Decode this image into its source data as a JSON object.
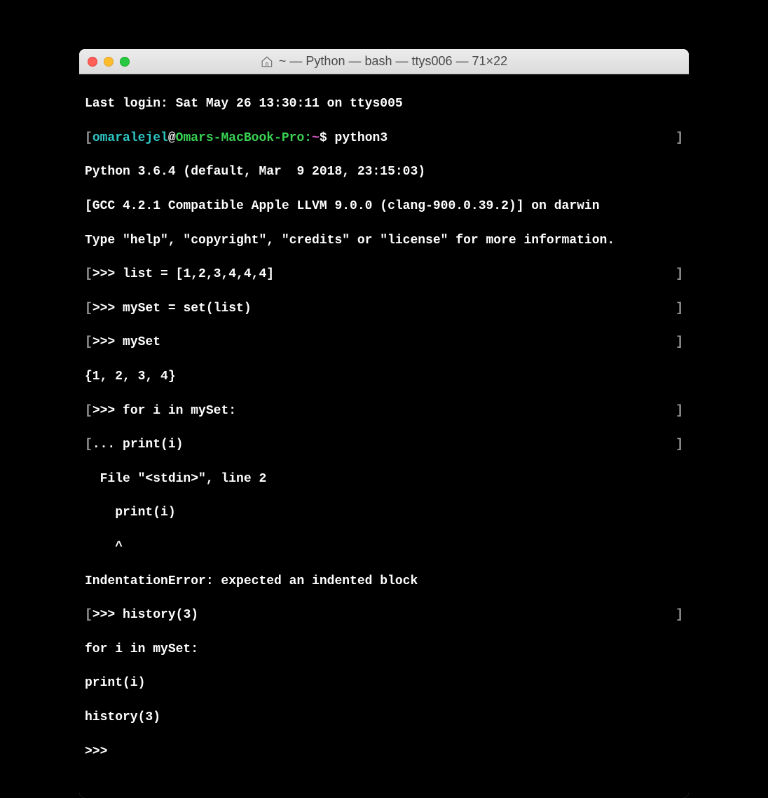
{
  "window": {
    "title": "~ — Python — bash — ttys006 — 71×22"
  },
  "colors": {
    "user": "#2fc6c3",
    "host": "#39d353",
    "path": "#e05bce",
    "bracket": "#9a9a9a"
  },
  "prompt": {
    "user": "omaralejel",
    "at": "@",
    "host": "Omars-MacBook-Pro:",
    "path": "~",
    "dollar": "$"
  },
  "terminal": {
    "last_login": "Last login: Sat May 26 13:30:11 on ttys005",
    "command_python": " python3",
    "python_version": "Python 3.6.4 (default, Mar  9 2018, 23:15:03) ",
    "python_gcc": "[GCC 4.2.1 Compatible Apple LLVM 9.0.0 (clang-900.0.39.2)] on darwin",
    "python_help": "Type \"help\", \"copyright\", \"credits\" or \"license\" for more information.",
    "repl_prompt": ">>> ",
    "repl_cont": "... ",
    "line_list": "list = [1,2,3,4,4,4]",
    "line_myset_assign": "mySet = set(list)",
    "line_myset": "mySet",
    "line_set_result": "{1, 2, 3, 4}",
    "line_for": "for i in mySet:",
    "line_print_cont": "print(i)",
    "line_file": "  File \"<stdin>\", line 2",
    "line_print_indent": "    print(i)",
    "line_caret": "    ^",
    "line_error": "IndentationError: expected an indented block",
    "line_history": "history(3)",
    "line_hist_for": "for i in mySet:",
    "line_hist_print": "print(i)",
    "line_hist_history": "history(3)",
    "final_prompt": ">>> "
  }
}
